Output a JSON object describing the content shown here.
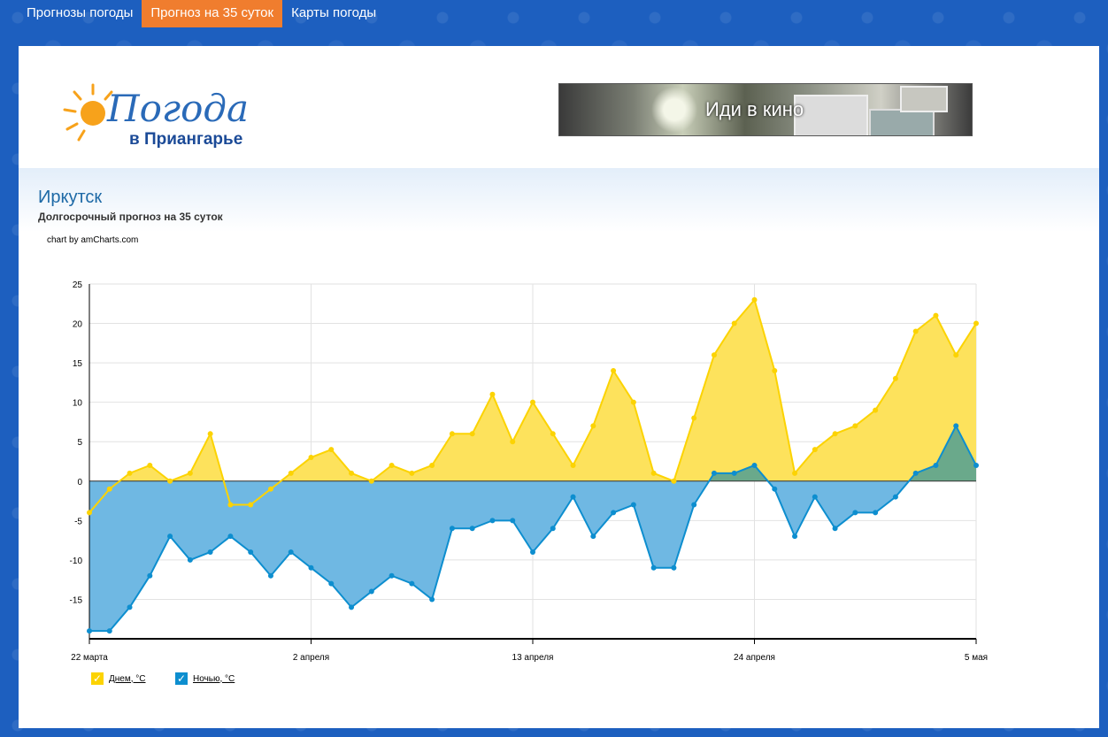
{
  "nav": {
    "items": [
      {
        "label": "Прогнозы погоды",
        "active": false
      },
      {
        "label": "Прогноз на 35 суток",
        "active": true
      },
      {
        "label": "Карты погоды",
        "active": false
      }
    ]
  },
  "logo": {
    "word": "Погода",
    "region": "в Приангарье"
  },
  "banner": {
    "text": "Иди в кино"
  },
  "page": {
    "city": "Иркутск",
    "subtitle": "Долгосрочный прогноз на 35 суток",
    "credit": "chart by amCharts.com"
  },
  "colors": {
    "day": "#fcd302",
    "day_fill": "#fde25c",
    "night": "#0d8ecf",
    "night_fill": "#6fb8e3",
    "overlap_fill": "#6aa98b",
    "nav_active": "#f07d2e",
    "page_bg": "#1d5fbf"
  },
  "chart_data": {
    "type": "area",
    "x_tick_labels": [
      "22 марта",
      "2 апреля",
      "13 апреля",
      "24 апреля",
      "5 мая"
    ],
    "x_start": "22 марта",
    "x_end": "5 мая",
    "ylim": [
      -20,
      25
    ],
    "y_ticks": [
      25,
      20,
      15,
      10,
      5,
      0,
      -5,
      -10,
      -15
    ],
    "grid": true,
    "legend": "bottom-left",
    "series": [
      {
        "name": "Днем, °C",
        "values": [
          -4,
          -1,
          1,
          2,
          0,
          1,
          6,
          -3,
          -3,
          -1,
          1,
          3,
          4,
          1,
          0,
          2,
          1,
          2,
          6,
          6,
          11,
          5,
          10,
          6,
          2,
          7,
          14,
          10,
          1,
          0,
          8,
          16,
          20,
          23,
          14,
          1,
          4,
          6,
          7,
          9,
          13,
          19,
          21,
          16,
          20
        ]
      },
      {
        "name": "Ночью, °C",
        "values": [
          -19,
          -19,
          -16,
          -12,
          -7,
          -10,
          -9,
          -7,
          -9,
          -12,
          -9,
          -11,
          -13,
          -16,
          -14,
          -12,
          -13,
          -15,
          -6,
          -6,
          -5,
          -5,
          -9,
          -6,
          -2,
          -7,
          -4,
          -3,
          -11,
          -11,
          -3,
          1,
          1,
          2,
          -1,
          -7,
          -2,
          -6,
          -4,
          -4,
          -2,
          1,
          2,
          7,
          2
        ]
      }
    ]
  }
}
